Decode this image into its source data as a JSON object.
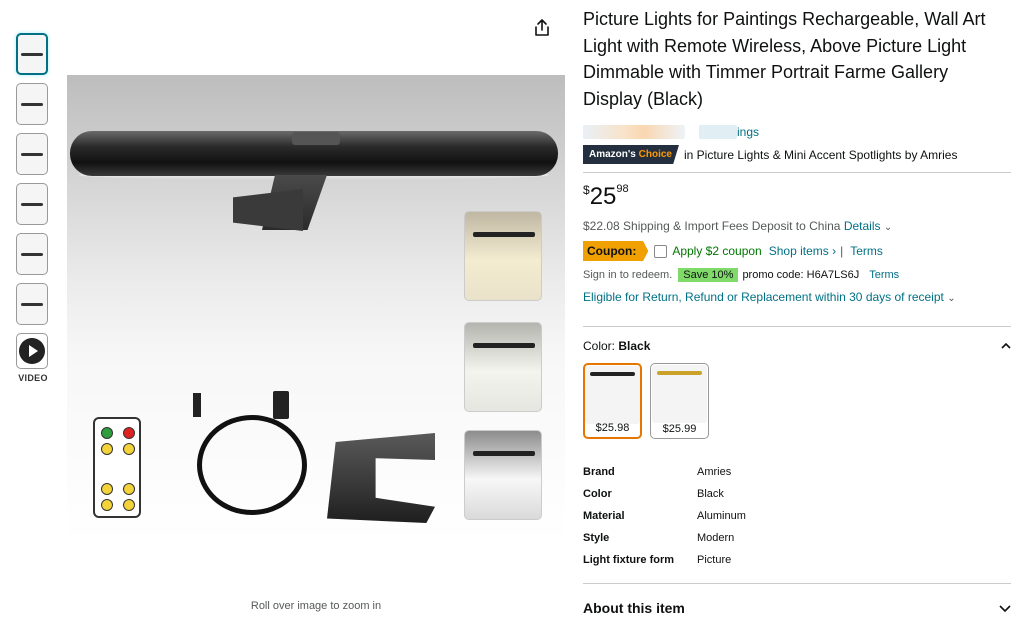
{
  "gallery": {
    "thumbnails": [
      "image-1",
      "image-2",
      "image-3",
      "image-4",
      "image-5",
      "image-6"
    ],
    "video_label": "VIDEO",
    "zoom_hint": "Roll over image to zoom in"
  },
  "product": {
    "title": "Picture Lights for Paintings Rechargeable, Wall Art Light with Remote Wireless, Above Picture Light Dimmable with Timmer Portrait Farme Gallery Display (Black)",
    "ratings_text": "ings",
    "badge_prefix": "Amazon's",
    "badge_choice": "Choice",
    "badge_in": "in",
    "badge_category": "Picture Lights & Mini Accent Spotlights",
    "badge_by": "by Amries"
  },
  "price": {
    "symbol": "$",
    "whole": "25",
    "fraction": "98",
    "shipping": "$22.08 Shipping & Import Fees Deposit to China",
    "details_link": "Details"
  },
  "coupon": {
    "label": "Coupon:",
    "apply": "Apply $2 coupon",
    "shop": "Shop items ›",
    "separator": "|",
    "terms": "Terms"
  },
  "promo": {
    "sign_in": "Sign in to redeem.",
    "save": "Save 10%",
    "code": "promo code: H6A7LS6J",
    "terms": "Terms"
  },
  "returns": "Eligible for Return, Refund or Replacement within 30 days of receipt",
  "color": {
    "label": "Color:",
    "selected": "Black",
    "variants": [
      {
        "price": "$25.98",
        "bar_color": "#222222"
      },
      {
        "price": "$25.99",
        "bar_color": "#c9a227"
      }
    ]
  },
  "specs": [
    {
      "key": "Brand",
      "value": "Amries"
    },
    {
      "key": "Color",
      "value": "Black"
    },
    {
      "key": "Material",
      "value": "Aluminum"
    },
    {
      "key": "Style",
      "value": "Modern"
    },
    {
      "key": "Light fixture form",
      "value": "Picture"
    }
  ],
  "about": "About this item"
}
